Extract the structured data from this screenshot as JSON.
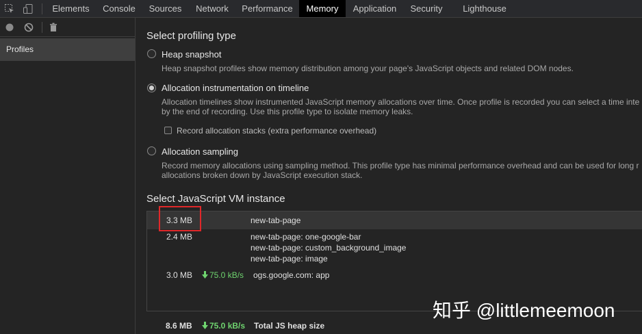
{
  "tabs": [
    {
      "label": "Elements"
    },
    {
      "label": "Console"
    },
    {
      "label": "Sources"
    },
    {
      "label": "Network"
    },
    {
      "label": "Performance"
    },
    {
      "label": "Memory",
      "active": true
    },
    {
      "label": "Application"
    },
    {
      "label": "Security"
    },
    {
      "label": "Lighthouse"
    }
  ],
  "toolbar_icons": [
    "inspect-element-icon",
    "device-toolbar-icon"
  ],
  "profiler_tools": [
    "record-icon",
    "clear-all-icon",
    "trash-icon"
  ],
  "sidebar": {
    "profiles_label": "Profiles"
  },
  "profiling": {
    "title": "Select profiling type",
    "options": [
      {
        "label": "Heap snapshot",
        "desc_lines": [
          "Heap snapshot profiles show memory distribution among your page's JavaScript objects and related DOM nodes."
        ],
        "checked": false
      },
      {
        "label": "Allocation instrumentation on timeline",
        "desc_lines": [
          "Allocation timelines show instrumented JavaScript memory allocations over time. Once profile is recorded you can select a time inte",
          "by the end of recording. Use this profile type to isolate memory leaks."
        ],
        "checked": true,
        "checkbox_label": "Record allocation stacks (extra performance overhead)"
      },
      {
        "label": "Allocation sampling",
        "desc_lines": [
          "Record memory allocations using sampling method. This profile type has minimal performance overhead and can be used for long r",
          "allocations broken down by JavaScript execution stack."
        ],
        "checked": false
      }
    ]
  },
  "vm": {
    "title": "Select JavaScript VM instance",
    "instances": [
      {
        "size": "3.3 MB",
        "speed": "",
        "names": [
          "new-tab-page"
        ],
        "selected": true
      },
      {
        "size": "2.4 MB",
        "speed": "",
        "names": [
          "new-tab-page: one-google-bar",
          "new-tab-page: custom_background_image",
          "new-tab-page: image"
        ]
      },
      {
        "size": "3.0 MB",
        "speed": "75.0 kB/s",
        "names": [
          "ogs.google.com: app"
        ]
      }
    ],
    "total": {
      "size": "8.6 MB",
      "speed": "75.0 kB/s",
      "label": "Total JS heap size"
    }
  },
  "watermark": "知乎 @littlemeemoon",
  "colors": {
    "accent_green": "#6fd46f",
    "highlight_red": "#e0282a",
    "active_tab_bg": "#000000"
  }
}
